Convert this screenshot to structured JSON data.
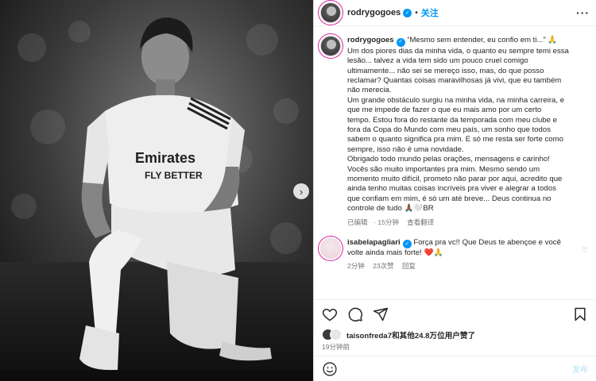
{
  "post": {
    "username": "rodrygogoes",
    "follow_label": "关注",
    "more_label": "···",
    "caption_quote": "“Mesmo sem entender, eu confio em ti...” 🙏",
    "caption_lines": [
      "Um dos piores dias da minha vida, o quanto eu sempre temi essa",
      "lesão... talvez a vida tem sido um pouco cruel comigo",
      "ultimamente... não sei se mereço isso, mas, do que posso",
      "reclamar? Quantas coisas maravilhosas já vivi, que eu também",
      "não merecia.",
      "Um grande obstáculo surgiu na minha vida, na minha carreira, e",
      "que me impede de fazer o que eu mais amo por um certo",
      "tempo. Estou fora do restante da temporada com meu clube e",
      "fora da Copa do Mundo com meu país, um sonho que todos",
      "sabem o quanto significa pra mim. E só me resta ser forte como",
      "sempre, isso não é uma novidade.",
      "Obrigado todo mundo pelas orações, mensagens e carinho!",
      "Vocês são muito importantes pra mim. Mesmo sendo um",
      "momento muito difícil, prometo não parar por aqui, acredito que",
      "ainda tenho muitas coisas incríveis pra viver e alegrar a todos",
      "que confiam em mim, é só um até breve... Deus continua no",
      "controle de tudo 🙏🏾🤍BR"
    ],
    "edited_label": "已编辑",
    "edited_time": "15分钟",
    "translate_label": "查看翻译"
  },
  "comment": {
    "username": "isabelapagliari",
    "text_lines": [
      "Força pra vc!! Que Deus te abençoe e você",
      "volte ainda mais forte! ❤️🙏"
    ],
    "time": "2分钟",
    "likes": "23次赞",
    "reply_label": "回复"
  },
  "likes": {
    "user": "taisonfreda7",
    "rest": "和其他24.8万位用户赞了"
  },
  "timestamp": "19分钟前",
  "input": {
    "placeholder": "",
    "emoji_icon": "smile-icon",
    "post_label": "发布"
  },
  "colors": {
    "accent": "#0095f6",
    "muted": "#737373",
    "post_disabled": "#b2dffc",
    "like_red": "#ed4956"
  }
}
